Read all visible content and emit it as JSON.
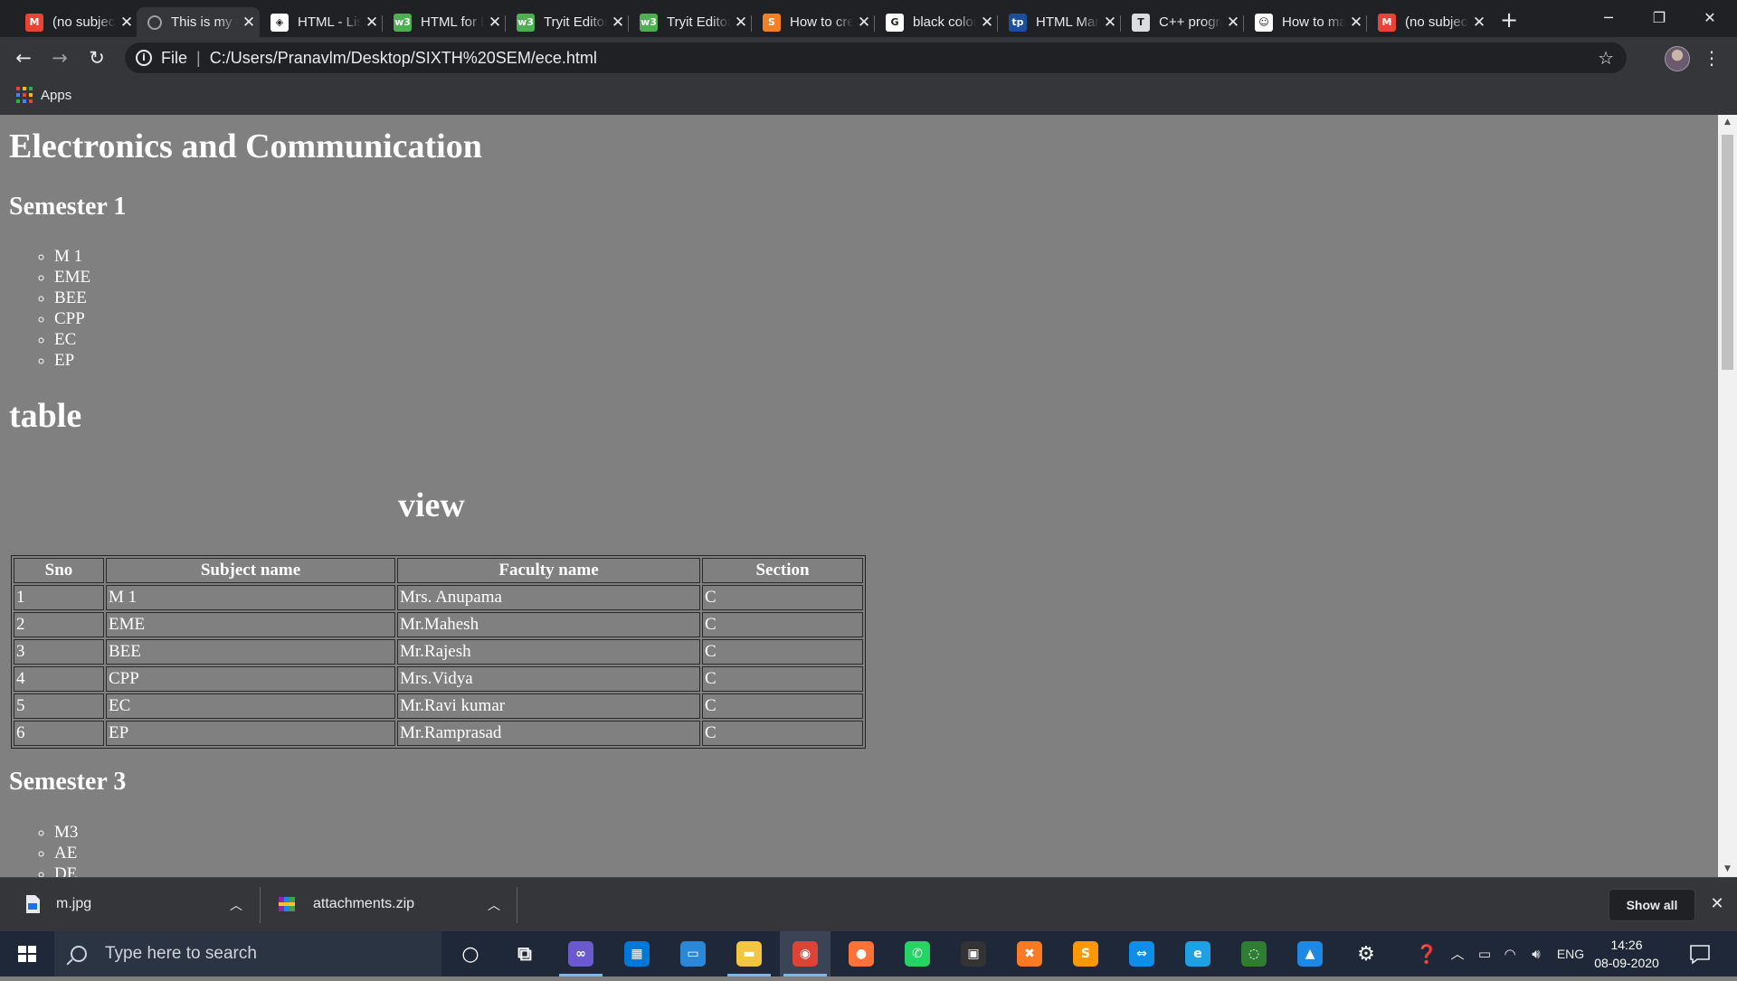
{
  "browser": {
    "tabs": [
      {
        "title": "(no subject)",
        "icon": "gmail-icon",
        "color": "#ea4335",
        "glyph": "M"
      },
      {
        "title": "This is my webpage",
        "icon": "loading-icon",
        "color": "#5f6368",
        "glyph": "",
        "active": true
      },
      {
        "title": "HTML - Lists",
        "icon": "webpage-icon",
        "color": "#ffffff",
        "glyph": "◈"
      },
      {
        "title": "HTML for Beginners",
        "icon": "w3schools-icon",
        "color": "#4caf50",
        "glyph": "w3"
      },
      {
        "title": "Tryit Editor",
        "icon": "w3schools-icon",
        "color": "#4caf50",
        "glyph": "w3"
      },
      {
        "title": "Tryit Editor",
        "icon": "w3schools-icon",
        "color": "#4caf50",
        "glyph": "w3"
      },
      {
        "title": "How to create a table",
        "icon": "stackoverflow-icon",
        "color": "#f48024",
        "glyph": "S"
      },
      {
        "title": "black color code",
        "icon": "google-icon",
        "color": "#ffffff",
        "glyph": "G"
      },
      {
        "title": "HTML Marquee",
        "icon": "tutorialspoint-icon",
        "color": "#1a4f9e",
        "glyph": "tp"
      },
      {
        "title": "C++ programs",
        "icon": "text-icon",
        "color": "#dadce0",
        "glyph": "T"
      },
      {
        "title": "How to make",
        "icon": "profile-icon",
        "color": "#ffffff",
        "glyph": "☺"
      },
      {
        "title": "(no subject)",
        "icon": "gmail-icon",
        "color": "#ea4335",
        "glyph": "M"
      }
    ],
    "url_scheme": "File",
    "url": "C:/Users/Pranavlm/Desktop/SIXTH%20SEM/ece.html",
    "bookmarks": {
      "apps_label": "Apps"
    }
  },
  "page": {
    "title": "Electronics and Communication",
    "semester1": {
      "heading": "Semester 1",
      "subjects": [
        "M 1",
        "EME",
        "BEE",
        "CPP",
        "EC",
        "EP"
      ]
    },
    "table_heading": "table",
    "table_caption": "view",
    "table": {
      "headers": [
        "Sno",
        "Subject name",
        "Faculty name",
        "Section"
      ],
      "rows": [
        [
          "1",
          "M 1",
          "Mrs. Anupama",
          "C"
        ],
        [
          "2",
          "EME",
          "Mr.Mahesh",
          "C"
        ],
        [
          "3",
          "BEE",
          "Mr.Rajesh",
          "C"
        ],
        [
          "4",
          "CPP",
          "Mrs.Vidya",
          "C"
        ],
        [
          "5",
          "EC",
          "Mr.Ravi kumar",
          "C"
        ],
        [
          "6",
          "EP",
          "Mr.Ramprasad",
          "C"
        ]
      ]
    },
    "semester3": {
      "heading": "Semester 3",
      "subjects": [
        "M3",
        "AE",
        "DE"
      ]
    }
  },
  "downloads": {
    "items": [
      {
        "name": "m.jpg",
        "icon": "image-file-icon"
      },
      {
        "name": "attachments.zip",
        "icon": "zip-archive-icon"
      }
    ],
    "show_all": "Show all"
  },
  "taskbar": {
    "search_placeholder": "Type here to search",
    "apps": [
      {
        "name": "cortana-icon",
        "glyph": "○",
        "color": "transparent"
      },
      {
        "name": "task-view-icon",
        "glyph": "⧉",
        "color": "transparent"
      },
      {
        "name": "infinity-app-icon",
        "glyph": "∞",
        "color": "#6a5acd",
        "running": true
      },
      {
        "name": "store-icon",
        "glyph": "▦",
        "color": "#0078d7"
      },
      {
        "name": "remote-desktop-icon",
        "glyph": "▭",
        "color": "#2b88d8"
      },
      {
        "name": "file-explorer-icon",
        "glyph": "▬",
        "color": "#f4c542",
        "running": true
      },
      {
        "name": "chrome-icon",
        "glyph": "◉",
        "color": "#db4437",
        "running": true,
        "active": true
      },
      {
        "name": "firefox-icon",
        "glyph": "●",
        "color": "#ff7139"
      },
      {
        "name": "whatsapp-icon",
        "glyph": "✆",
        "color": "#25d366"
      },
      {
        "name": "dark-app-icon",
        "glyph": "▣",
        "color": "#333333"
      },
      {
        "name": "xampp-icon",
        "glyph": "✖",
        "color": "#fb7a24"
      },
      {
        "name": "sublime-text-icon",
        "glyph": "S",
        "color": "#ff9800"
      },
      {
        "name": "teamviewer-icon",
        "glyph": "⇔",
        "color": "#0e8ee9"
      },
      {
        "name": "edge-icon",
        "glyph": "e",
        "color": "#1fa0e3"
      },
      {
        "name": "refresh-app-icon",
        "glyph": "◌",
        "color": "#2e7d32"
      },
      {
        "name": "photos-icon",
        "glyph": "▲",
        "color": "#1e88e5"
      },
      {
        "name": "settings-icon",
        "glyph": "⚙",
        "color": "transparent"
      }
    ],
    "tray_language": "ENG",
    "time": "14:26",
    "date": "08-09-2020"
  }
}
